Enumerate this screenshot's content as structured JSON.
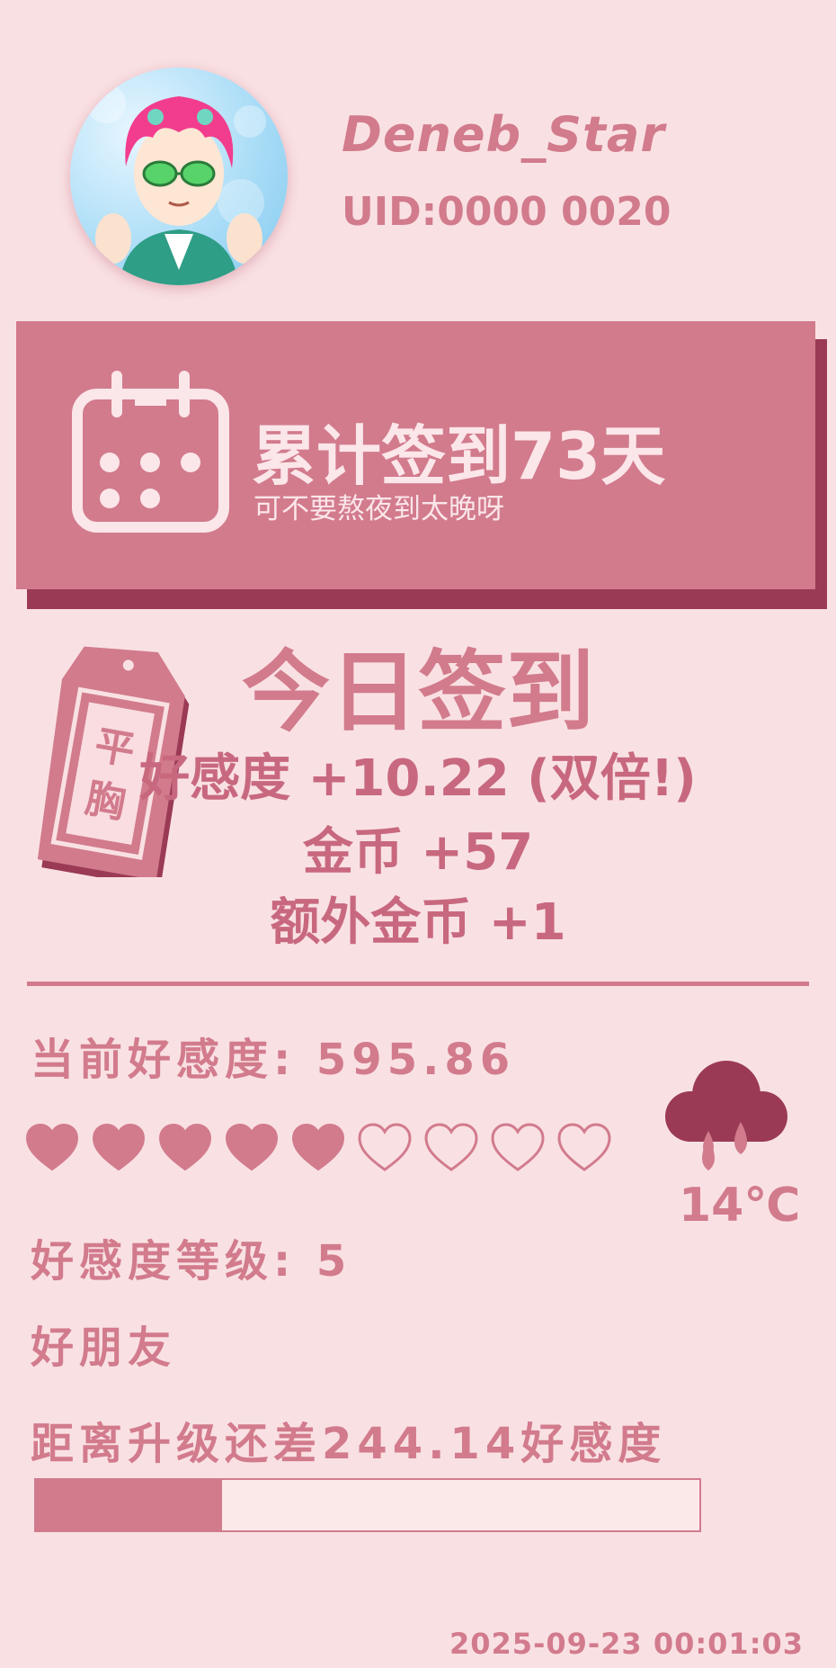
{
  "profile": {
    "username": "Deneb_Star",
    "uid": "UID:0000 0020"
  },
  "banner": {
    "title": "累计签到73天",
    "subtitle": "可不要熬夜到太晚呀",
    "icon": "calendar-icon"
  },
  "tag": {
    "line1": "平",
    "line2": "胸"
  },
  "today": {
    "title": "今日签到",
    "favor_gain": "好感度 +10.22 (双倍!)",
    "coin_gain": "金币 +57",
    "extra_coin": "额外金币 +1"
  },
  "stats": {
    "current_favor": "当前好感度: 595.86",
    "hearts_filled": 5,
    "hearts_total": 9,
    "level": "好感度等级: 5",
    "rank_title": "好朋友",
    "to_next_level": "距离升级还差244.14好感度",
    "progress_fraction": 0.28
  },
  "weather": {
    "icon": "rain-cloud-icon",
    "temperature": "14℃"
  },
  "timestamp": "2025-09-23  00:01:03",
  "colors": {
    "background": "#f9e1e3",
    "accent": "#d27b8d",
    "accent_dark": "#9b3a55",
    "light_text": "#fbe6e9"
  }
}
